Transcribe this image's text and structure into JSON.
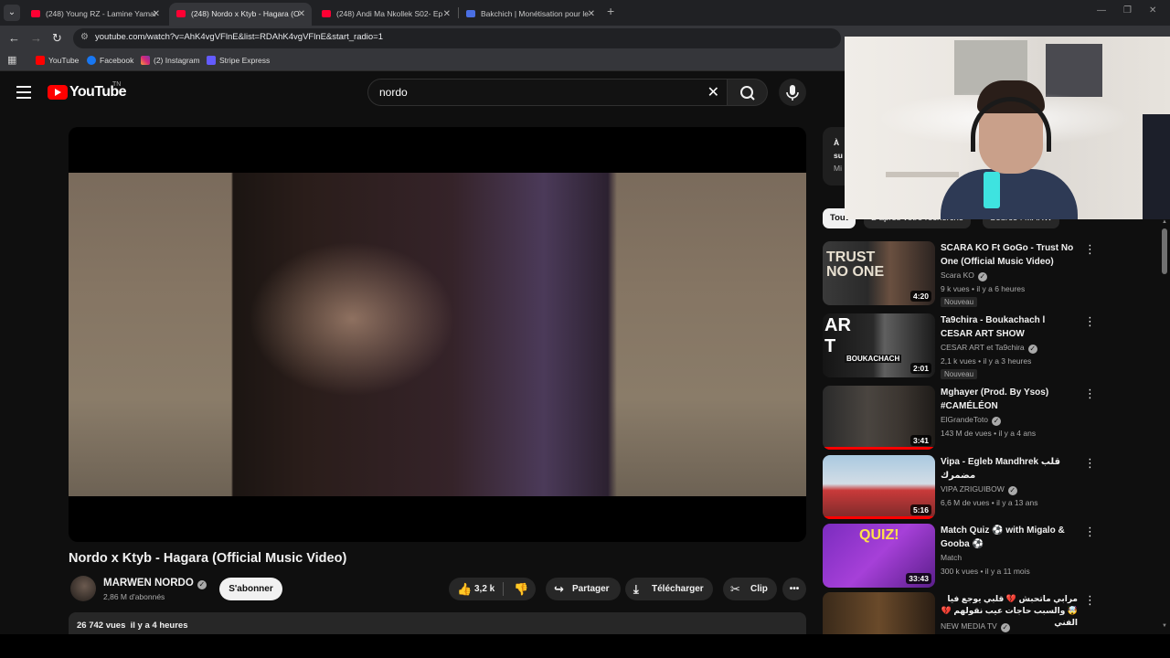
{
  "browser": {
    "tabs": [
      {
        "label": "(248) Young RZ - Lamine Yamal",
        "favicon": "youtube-favicon"
      },
      {
        "label": "(248) Nordo x Ktyb - Hagara (O",
        "favicon": "youtube-favicon",
        "active": true
      },
      {
        "label": "(248) Andi Ma Nkollek S02- Ep",
        "favicon": "youtube-favicon"
      },
      {
        "label": "Bakchich | Monétisation pour le",
        "favicon": "doc-favicon"
      }
    ],
    "url": "youtube.com/watch?v=AhK4vgVFlnE&list=RDAhK4vgVFlnE&start_radio=1",
    "bookmarks": [
      "YouTube",
      "Facebook",
      "(2) Instagram",
      "Stripe Express"
    ]
  },
  "header": {
    "logo": "YouTube",
    "country": "TN",
    "search_query": "nordo"
  },
  "video": {
    "title": "Nordo x Ktyb - Hagara (Official Music Video)",
    "channel": "MARWEN NORDO",
    "subscribers": "2,86 M d'abonnés",
    "subscribe_label": "S'abonner",
    "likes": "3,2 k",
    "share_label": "Partager",
    "download_label": "Télécharger",
    "clip_label": "Clip",
    "views": "26 742 vues",
    "age": "il y a 4 heures"
  },
  "sidebar": {
    "promo_line1": "À",
    "promo_line2": "su",
    "promo_line3": "Mi",
    "chips": [
      "Tout",
      "D'après votre recherche",
      "Source : MARW"
    ],
    "recommendations": [
      {
        "title": "SCARA KO Ft GoGo - Trust No One (Official Music Video)",
        "channel": "Scara KO",
        "meta": "9 k vues • il y a 6 heures",
        "duration": "4:20",
        "badge": "Nouveau"
      },
      {
        "title": "Ta9chira - Boukachach l CESAR ART SHOW",
        "channel": "CESAR ART et Ta9chira",
        "meta": "2,1 k vues • il y a 3 heures",
        "duration": "2:01",
        "badge": "Nouveau"
      },
      {
        "title": "Mghayer (Prod. By Ysos) #CAMÉLÉON",
        "channel": "ElGrandeToto",
        "meta": "143 M de vues • il y a 4 ans",
        "duration": "3:41",
        "progress": 1.0
      },
      {
        "title": "Vipa - Egleb Mandhrek قلب مضمرك",
        "channel": "VIPA ZRIGUIBOW",
        "meta": "6,6 M de vues • il y a 13 ans",
        "duration": "5:16",
        "progress": 1.0
      },
      {
        "title": "Match Quiz ⚽ with Migalo & Gooba ⚽",
        "channel": "Match",
        "meta": "300 k vues • il y a 11 mois",
        "duration": "33:43"
      },
      {
        "title": "مرابي ماتحبش 💔 قلبي يوجع فيا 🤯 والسبب حاجات عيب نقولهم 💔 الفني",
        "channel": "NEW MEDIA TV",
        "meta": "",
        "duration": ""
      }
    ]
  },
  "colors": {
    "accent": "#ff0000",
    "background": "#0f0f0f",
    "pill": "#272727"
  }
}
